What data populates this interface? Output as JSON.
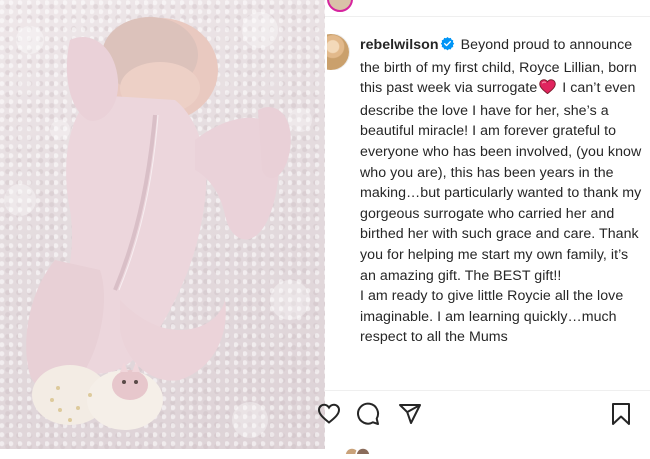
{
  "post": {
    "username": "rebelwilson",
    "caption_intro": "Beyond proud to announce the birth of my first child, Royce Lillian, born this past week via surrogate",
    "caption_after_heart": "I can’t even describe the love I have for her, she’s a beautiful miracle! I am forever grateful to everyone who has been involved, (you know who you are), this has been years in the making…but particularly wanted to thank my gorgeous surrogate who carried her and birthed her with such grace and care. Thank you for helping me start my own family, it’s an amazing gift. The BEST gift!!",
    "caption_second_paragraph": "I am ready to give little Roycie all the love imaginable. I am learning quickly…much respect to all the Mums"
  },
  "icons": {
    "verified": "verified-badge-icon",
    "heart": "red-heart-emoji-icon",
    "like": "heart-outline-icon",
    "comment": "comment-bubble-icon",
    "share": "paper-plane-icon",
    "save": "bookmark-icon"
  },
  "colors": {
    "verified_blue": "#0095f6",
    "heart_red": "#e0245e",
    "text": "#262626",
    "onesie_pink": "#ecd6dc"
  }
}
